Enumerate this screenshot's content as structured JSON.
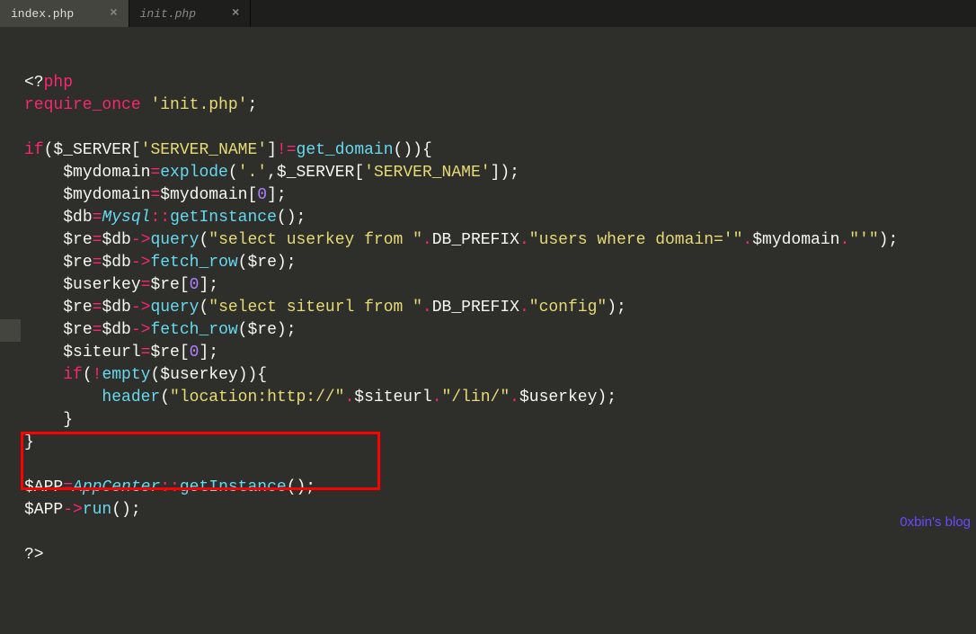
{
  "tabs": [
    {
      "title": "index.php",
      "active": true
    },
    {
      "title": "init.php",
      "active": false
    }
  ],
  "watermark": "0xbin's blog",
  "code": {
    "lines": [
      [
        {
          "t": "<?",
          "c": "pun"
        },
        {
          "t": "php",
          "c": "kw"
        }
      ],
      [
        {
          "t": "require_once ",
          "c": "kw"
        },
        {
          "t": "'init.php'",
          "c": "str"
        },
        {
          "t": ";",
          "c": "pun"
        }
      ],
      [],
      [
        {
          "t": "if",
          "c": "kw"
        },
        {
          "t": "(",
          "c": "pun"
        },
        {
          "t": "$_SERVER",
          "c": "var"
        },
        {
          "t": "[",
          "c": "pun"
        },
        {
          "t": "'SERVER_NAME'",
          "c": "str"
        },
        {
          "t": "]",
          "c": "pun"
        },
        {
          "t": "!=",
          "c": "op"
        },
        {
          "t": "get_domain",
          "c": "fn"
        },
        {
          "t": "()){",
          "c": "pun"
        }
      ],
      [
        {
          "t": "    ",
          "c": "pun"
        },
        {
          "t": "$mydomain",
          "c": "var"
        },
        {
          "t": "=",
          "c": "op"
        },
        {
          "t": "explode",
          "c": "fn"
        },
        {
          "t": "(",
          "c": "pun"
        },
        {
          "t": "'.'",
          "c": "str"
        },
        {
          "t": ",",
          "c": "pun"
        },
        {
          "t": "$_SERVER",
          "c": "var"
        },
        {
          "t": "[",
          "c": "pun"
        },
        {
          "t": "'SERVER_NAME'",
          "c": "str"
        },
        {
          "t": "]);",
          "c": "pun"
        }
      ],
      [
        {
          "t": "    ",
          "c": "pun"
        },
        {
          "t": "$mydomain",
          "c": "var"
        },
        {
          "t": "=",
          "c": "op"
        },
        {
          "t": "$mydomain",
          "c": "var"
        },
        {
          "t": "[",
          "c": "pun"
        },
        {
          "t": "0",
          "c": "num"
        },
        {
          "t": "];",
          "c": "pun"
        }
      ],
      [
        {
          "t": "    ",
          "c": "pun"
        },
        {
          "t": "$db",
          "c": "var"
        },
        {
          "t": "=",
          "c": "op"
        },
        {
          "t": "Mysql",
          "c": "cls"
        },
        {
          "t": "::",
          "c": "op"
        },
        {
          "t": "getInstance",
          "c": "fn"
        },
        {
          "t": "();",
          "c": "pun"
        }
      ],
      [
        {
          "t": "    ",
          "c": "pun"
        },
        {
          "t": "$re",
          "c": "var"
        },
        {
          "t": "=",
          "c": "op"
        },
        {
          "t": "$db",
          "c": "var"
        },
        {
          "t": "->",
          "c": "op"
        },
        {
          "t": "query",
          "c": "fn"
        },
        {
          "t": "(",
          "c": "pun"
        },
        {
          "t": "\"select userkey from \"",
          "c": "str"
        },
        {
          "t": ".",
          "c": "op"
        },
        {
          "t": "DB_PREFIX",
          "c": "var"
        },
        {
          "t": ".",
          "c": "op"
        },
        {
          "t": "\"users where domain='\"",
          "c": "str"
        },
        {
          "t": ".",
          "c": "op"
        },
        {
          "t": "$mydomain",
          "c": "var"
        },
        {
          "t": ".",
          "c": "op"
        },
        {
          "t": "\"'\"",
          "c": "str"
        },
        {
          "t": ");",
          "c": "pun"
        }
      ],
      [
        {
          "t": "    ",
          "c": "pun"
        },
        {
          "t": "$re",
          "c": "var"
        },
        {
          "t": "=",
          "c": "op"
        },
        {
          "t": "$db",
          "c": "var"
        },
        {
          "t": "->",
          "c": "op"
        },
        {
          "t": "fetch_row",
          "c": "fn"
        },
        {
          "t": "(",
          "c": "pun"
        },
        {
          "t": "$re",
          "c": "var"
        },
        {
          "t": ");",
          "c": "pun"
        }
      ],
      [
        {
          "t": "    ",
          "c": "pun"
        },
        {
          "t": "$userkey",
          "c": "var"
        },
        {
          "t": "=",
          "c": "op"
        },
        {
          "t": "$re",
          "c": "var"
        },
        {
          "t": "[",
          "c": "pun"
        },
        {
          "t": "0",
          "c": "num"
        },
        {
          "t": "];",
          "c": "pun"
        }
      ],
      [
        {
          "t": "    ",
          "c": "pun"
        },
        {
          "t": "$re",
          "c": "var"
        },
        {
          "t": "=",
          "c": "op"
        },
        {
          "t": "$db",
          "c": "var"
        },
        {
          "t": "->",
          "c": "op"
        },
        {
          "t": "query",
          "c": "fn"
        },
        {
          "t": "(",
          "c": "pun"
        },
        {
          "t": "\"select siteurl from \"",
          "c": "str"
        },
        {
          "t": ".",
          "c": "op"
        },
        {
          "t": "DB_PREFIX",
          "c": "var"
        },
        {
          "t": ".",
          "c": "op"
        },
        {
          "t": "\"config\"",
          "c": "str"
        },
        {
          "t": ");",
          "c": "pun"
        }
      ],
      [
        {
          "t": "    ",
          "c": "pun"
        },
        {
          "t": "$re",
          "c": "var"
        },
        {
          "t": "=",
          "c": "op"
        },
        {
          "t": "$db",
          "c": "var"
        },
        {
          "t": "->",
          "c": "op"
        },
        {
          "t": "fetch_row",
          "c": "fn"
        },
        {
          "t": "(",
          "c": "pun"
        },
        {
          "t": "$re",
          "c": "var"
        },
        {
          "t": ");",
          "c": "pun"
        }
      ],
      [
        {
          "t": "    ",
          "c": "pun"
        },
        {
          "t": "$siteurl",
          "c": "var"
        },
        {
          "t": "=",
          "c": "op"
        },
        {
          "t": "$re",
          "c": "var"
        },
        {
          "t": "[",
          "c": "pun"
        },
        {
          "t": "0",
          "c": "num"
        },
        {
          "t": "];",
          "c": "pun"
        }
      ],
      [
        {
          "t": "    ",
          "c": "pun"
        },
        {
          "t": "if",
          "c": "kw"
        },
        {
          "t": "(",
          "c": "pun"
        },
        {
          "t": "!",
          "c": "op"
        },
        {
          "t": "empty",
          "c": "fn"
        },
        {
          "t": "(",
          "c": "pun"
        },
        {
          "t": "$userkey",
          "c": "var"
        },
        {
          "t": ")){",
          "c": "pun"
        }
      ],
      [
        {
          "t": "        ",
          "c": "pun"
        },
        {
          "t": "header",
          "c": "fn"
        },
        {
          "t": "(",
          "c": "pun"
        },
        {
          "t": "\"location:http://\"",
          "c": "str"
        },
        {
          "t": ".",
          "c": "op"
        },
        {
          "t": "$siteurl",
          "c": "var"
        },
        {
          "t": ".",
          "c": "op"
        },
        {
          "t": "\"/lin/\"",
          "c": "str"
        },
        {
          "t": ".",
          "c": "op"
        },
        {
          "t": "$userkey",
          "c": "var"
        },
        {
          "t": ");",
          "c": "pun"
        }
      ],
      [
        {
          "t": "    }",
          "c": "pun"
        }
      ],
      [
        {
          "t": "}",
          "c": "pun"
        }
      ],
      [],
      [
        {
          "t": "$APP",
          "c": "var"
        },
        {
          "t": "=",
          "c": "op"
        },
        {
          "t": "AppCenter",
          "c": "cls"
        },
        {
          "t": "::",
          "c": "op"
        },
        {
          "t": "getInstance",
          "c": "fn"
        },
        {
          "t": "();",
          "c": "pun"
        }
      ],
      [
        {
          "t": "$APP",
          "c": "var"
        },
        {
          "t": "->",
          "c": "op"
        },
        {
          "t": "run",
          "c": "fn"
        },
        {
          "t": "();",
          "c": "pun"
        }
      ],
      [],
      [
        {
          "t": "?>",
          "c": "pun"
        }
      ]
    ]
  }
}
